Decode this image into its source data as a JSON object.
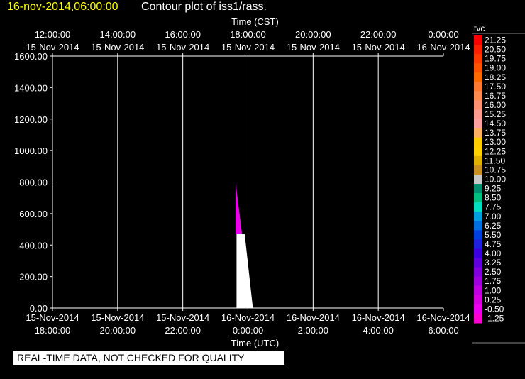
{
  "header": {
    "timestamp": "16-nov-2014,06:00:00",
    "title": "Contour plot of iss1/rass."
  },
  "footer": {
    "note": "REAL-TIME DATA, NOT CHECKED FOR QUALITY"
  },
  "colors": {
    "background": "#000000",
    "text": "#ffffff",
    "timestamp": "#ffff00",
    "grid": "#ffffff"
  },
  "chart_data": {
    "type": "heatmap",
    "title": "Contour plot of iss1/rass.",
    "xlabel_bottom": "Time (UTC)",
    "xlabel_top": "Time (CST)",
    "ylabel": "",
    "ylim": [
      0,
      1600
    ],
    "yticks": [
      "0.00",
      "200.00",
      "400.00",
      "600.00",
      "800.00",
      "1000.00",
      "1200.00",
      "1400.00",
      "1600.00"
    ],
    "x_utc_ticks": [
      [
        "15-Nov-2014",
        "18:00:00"
      ],
      [
        "15-Nov-2014",
        "20:00:00"
      ],
      [
        "15-Nov-2014",
        "22:00:00"
      ],
      [
        "16-Nov-2014",
        "0:00:00"
      ],
      [
        "16-Nov-2014",
        "2:00:00"
      ],
      [
        "16-Nov-2014",
        "4:00:00"
      ],
      [
        "16-Nov-2014",
        "6:00:00"
      ]
    ],
    "x_cst_ticks": [
      [
        "12:00:00",
        "15-Nov-2014"
      ],
      [
        "14:00:00",
        "15-Nov-2014"
      ],
      [
        "16:00:00",
        "15-Nov-2014"
      ],
      [
        "18:00:00",
        "15-Nov-2014"
      ],
      [
        "20:00:00",
        "15-Nov-2014"
      ],
      [
        "22:00:00",
        "15-Nov-2014"
      ],
      [
        "0:00:00",
        "16-Nov-2014"
      ]
    ],
    "xlim_hours_utc": [
      18,
      30
    ],
    "grid": true,
    "contour_regions": [
      {
        "color": "#ffffff",
        "points": [
          [
            23.65,
            0
          ],
          [
            23.65,
            470
          ],
          [
            23.9,
            470
          ],
          [
            24.15,
            0
          ]
        ]
      },
      {
        "color": "#ee00ee",
        "points": [
          [
            23.62,
            800
          ],
          [
            23.62,
            470
          ],
          [
            23.82,
            470
          ]
        ]
      }
    ],
    "colorbar": {
      "label": "tvc",
      "levels": [
        "21.25",
        "20.50",
        "19.75",
        "19.00",
        "18.25",
        "17.50",
        "16.75",
        "16.00",
        "15.25",
        "14.50",
        "13.75",
        "13.00",
        "12.25",
        "11.50",
        "10.75",
        "10.00",
        "9.25",
        "8.50",
        "7.75",
        "7.00",
        "6.25",
        "5.50",
        "4.75",
        "4.00",
        "3.25",
        "2.50",
        "1.75",
        "1.00",
        "0.25",
        "-0.50",
        "-1.25"
      ],
      "colors": [
        "#ff0000",
        "#ff2000",
        "#ff3a00",
        "#ff5200",
        "#ff6a00",
        "#ff7a30",
        "#ff8a50",
        "#ff9070",
        "#ff9a90",
        "#ffa0a0",
        "#ffb060",
        "#ffcc00",
        "#ffd000",
        "#e0b000",
        "#c89020",
        "#c8c8c8",
        "#009070",
        "#00c080",
        "#00e0c0",
        "#00a0e0",
        "#0070e0",
        "#0040e0",
        "#2020e0",
        "#3a00e0",
        "#6000e0",
        "#8000e0",
        "#a000e0",
        "#c000e0",
        "#d800e0",
        "#ee00ee",
        "#ff00d0"
      ]
    }
  }
}
